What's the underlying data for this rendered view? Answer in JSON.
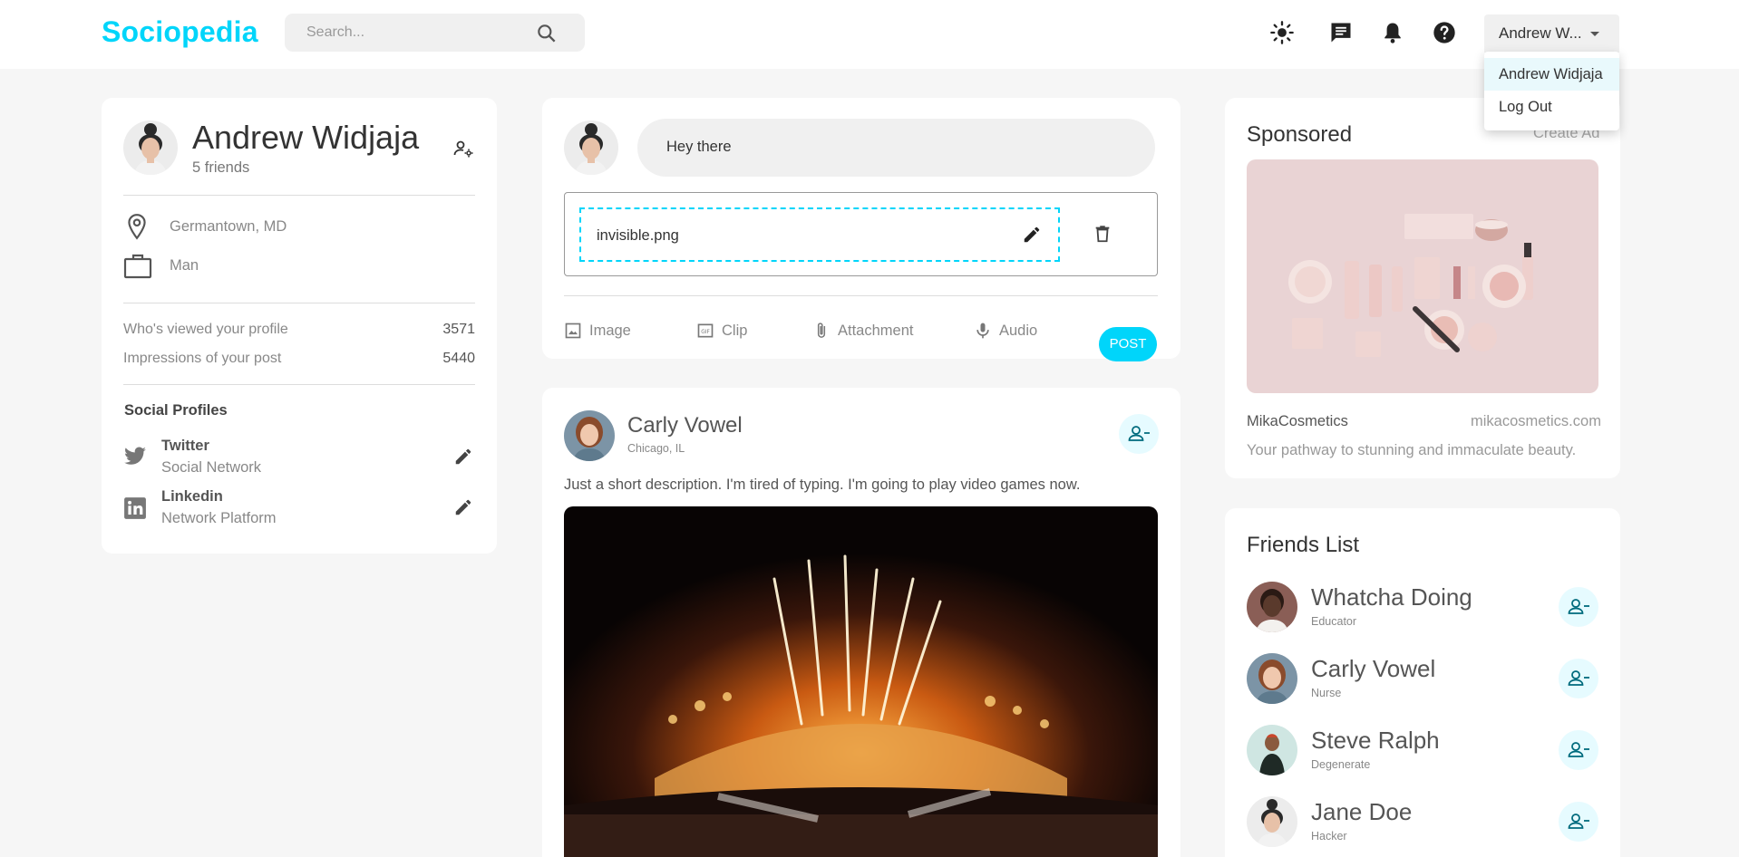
{
  "app": {
    "logo": "Sociopedia"
  },
  "navbar": {
    "search_placeholder": "Search...",
    "user_select": "Andrew W...",
    "user_menu": [
      "Andrew Widjaja",
      "Log Out"
    ],
    "icons": [
      "light-mode-icon",
      "message-icon",
      "notifications-icon",
      "help-icon"
    ]
  },
  "user_widget": {
    "name": "Andrew Widjaja",
    "friends": "5 friends",
    "location": "Germantown, MD",
    "occupation": "Man",
    "stats": [
      {
        "label": "Who's viewed your profile",
        "value": "3571"
      },
      {
        "label": "Impressions of your post",
        "value": "5440"
      }
    ],
    "social_heading": "Social Profiles",
    "socials": [
      {
        "name": "Twitter",
        "sub": "Social Network",
        "icon": "twitter-icon"
      },
      {
        "name": "Linkedin",
        "sub": "Network Platform",
        "icon": "linkedin-icon"
      }
    ]
  },
  "composer": {
    "input_value": "Hey there",
    "file_name": "invisible.png",
    "actions": [
      "Image",
      "Clip",
      "Attachment",
      "Audio"
    ],
    "post_label": "POST"
  },
  "feed_post": {
    "name": "Carly Vowel",
    "location": "Chicago, IL",
    "description": "Just a short description. I'm tired of typing. I'm going to play video games now."
  },
  "ad": {
    "title": "Sponsored",
    "create": "Create Ad",
    "brand": "MikaCosmetics",
    "url": "mikacosmetics.com",
    "tagline": "Your pathway to stunning and immaculate beauty."
  },
  "friends_list": {
    "title": "Friends List",
    "friends": [
      {
        "name": "Whatcha Doing",
        "sub": "Educator"
      },
      {
        "name": "Carly Vowel",
        "sub": "Nurse"
      },
      {
        "name": "Steve Ralph",
        "sub": "Degenerate"
      },
      {
        "name": "Jane Doe",
        "sub": "Hacker"
      }
    ]
  },
  "colors": {
    "primary": "#00d5fa",
    "background": "#f6f6f6",
    "primary_light": "#e6fbff"
  }
}
